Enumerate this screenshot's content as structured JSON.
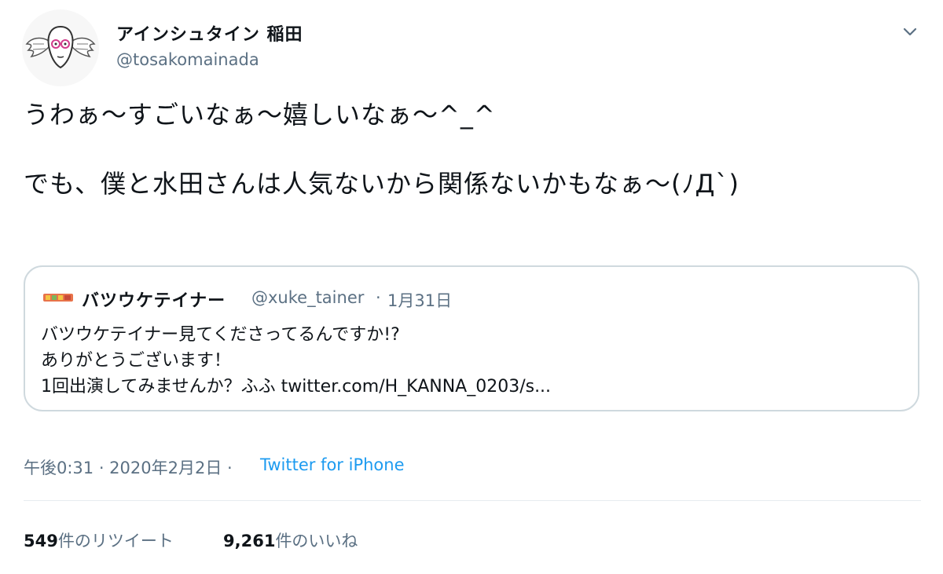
{
  "author": {
    "name": "アインシュタイン 稲田",
    "handle": "@tosakomainada"
  },
  "tweet": {
    "text": "うわぁ〜すごいなぁ〜嬉しいなぁ〜^_^\n\nでも、僕と水田さんは人気ないから関係ないかもなぁ〜(ﾉД`)"
  },
  "quoted_tweet": {
    "name": "バツウケテイナー",
    "handle": "@xuke_tainer",
    "separator": "·",
    "date": "1月31日",
    "text": "バツウケテイナー見てくださってるんですか!?\nありがとうございます！\n1回出演してみませんか？ふふ twitter.com/H_KANNA_0203/s..."
  },
  "meta": {
    "time_date": "午後0:31 · 2020年2月2日 ·",
    "source": "Twitter for iPhone"
  },
  "stats": {
    "retweets_count": "549",
    "retweets_label": "件のリツイート",
    "likes_count": "9,261",
    "likes_label": "件のいいね"
  },
  "icons": {
    "menu": "chevron-down-icon",
    "avatar": "winged-face-avatar",
    "quote_avatar": "banner-logo"
  },
  "colors": {
    "link": "#1d9bf0",
    "secondary_text": "#5b7083",
    "border": "#cfd9de"
  }
}
